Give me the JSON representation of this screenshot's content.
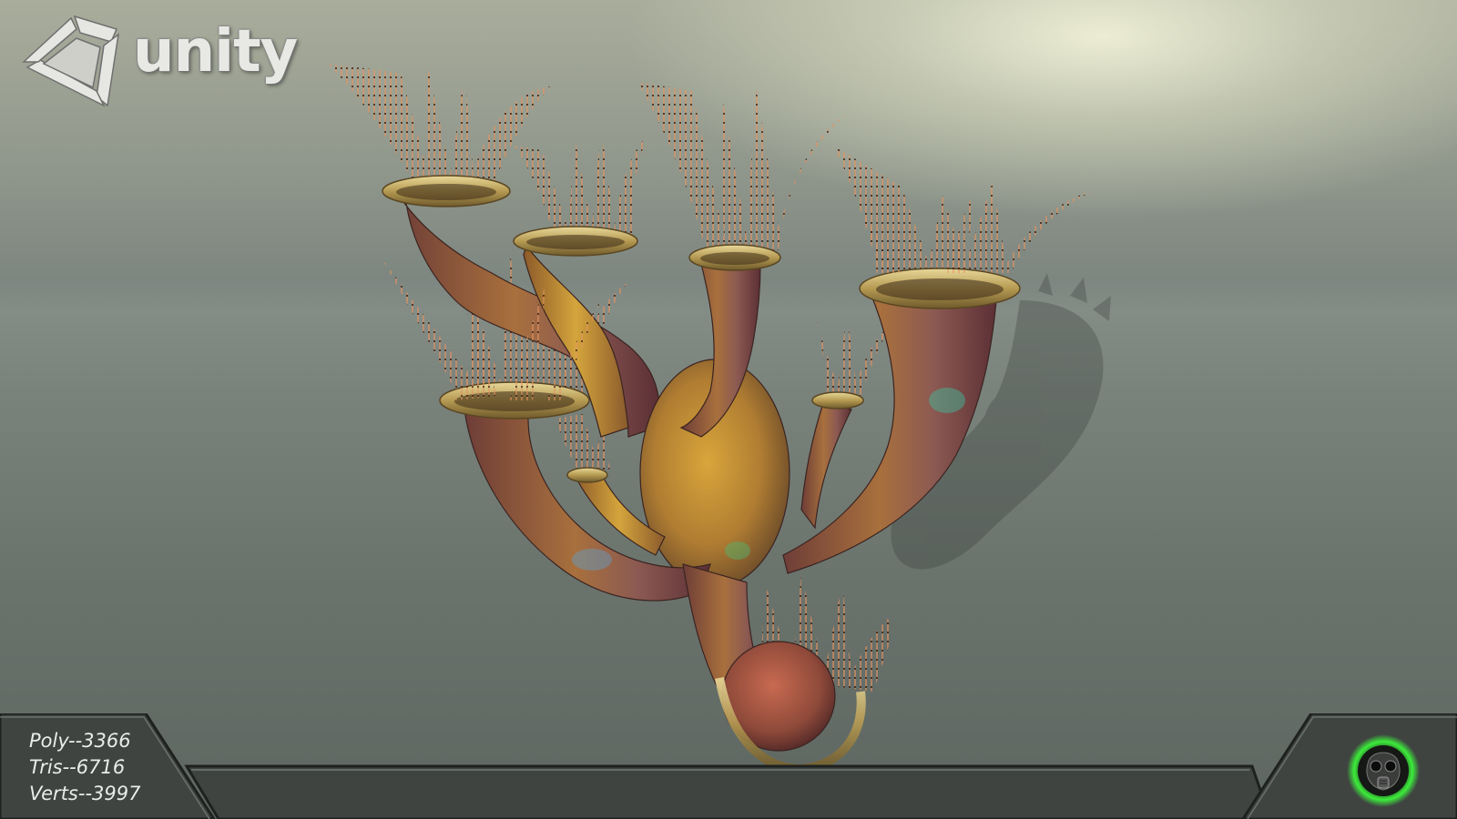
{
  "logo": {
    "word": "unity",
    "icon": "unity-cube-icon"
  },
  "stats": {
    "poly": "Poly--3366",
    "tris": "Tris--6716",
    "verts": "Verts--3997"
  },
  "emblem": {
    "icon": "gas-mask-icon",
    "glow_color": "#3cff3a"
  },
  "colors": {
    "hud_bar": "#3f4441",
    "hud_border": "#1e211f",
    "plant_rim": "#c9b46a",
    "plant_body": "#8a5a3c",
    "plant_yellow": "#c99a33",
    "bristle": "#d78a55"
  }
}
